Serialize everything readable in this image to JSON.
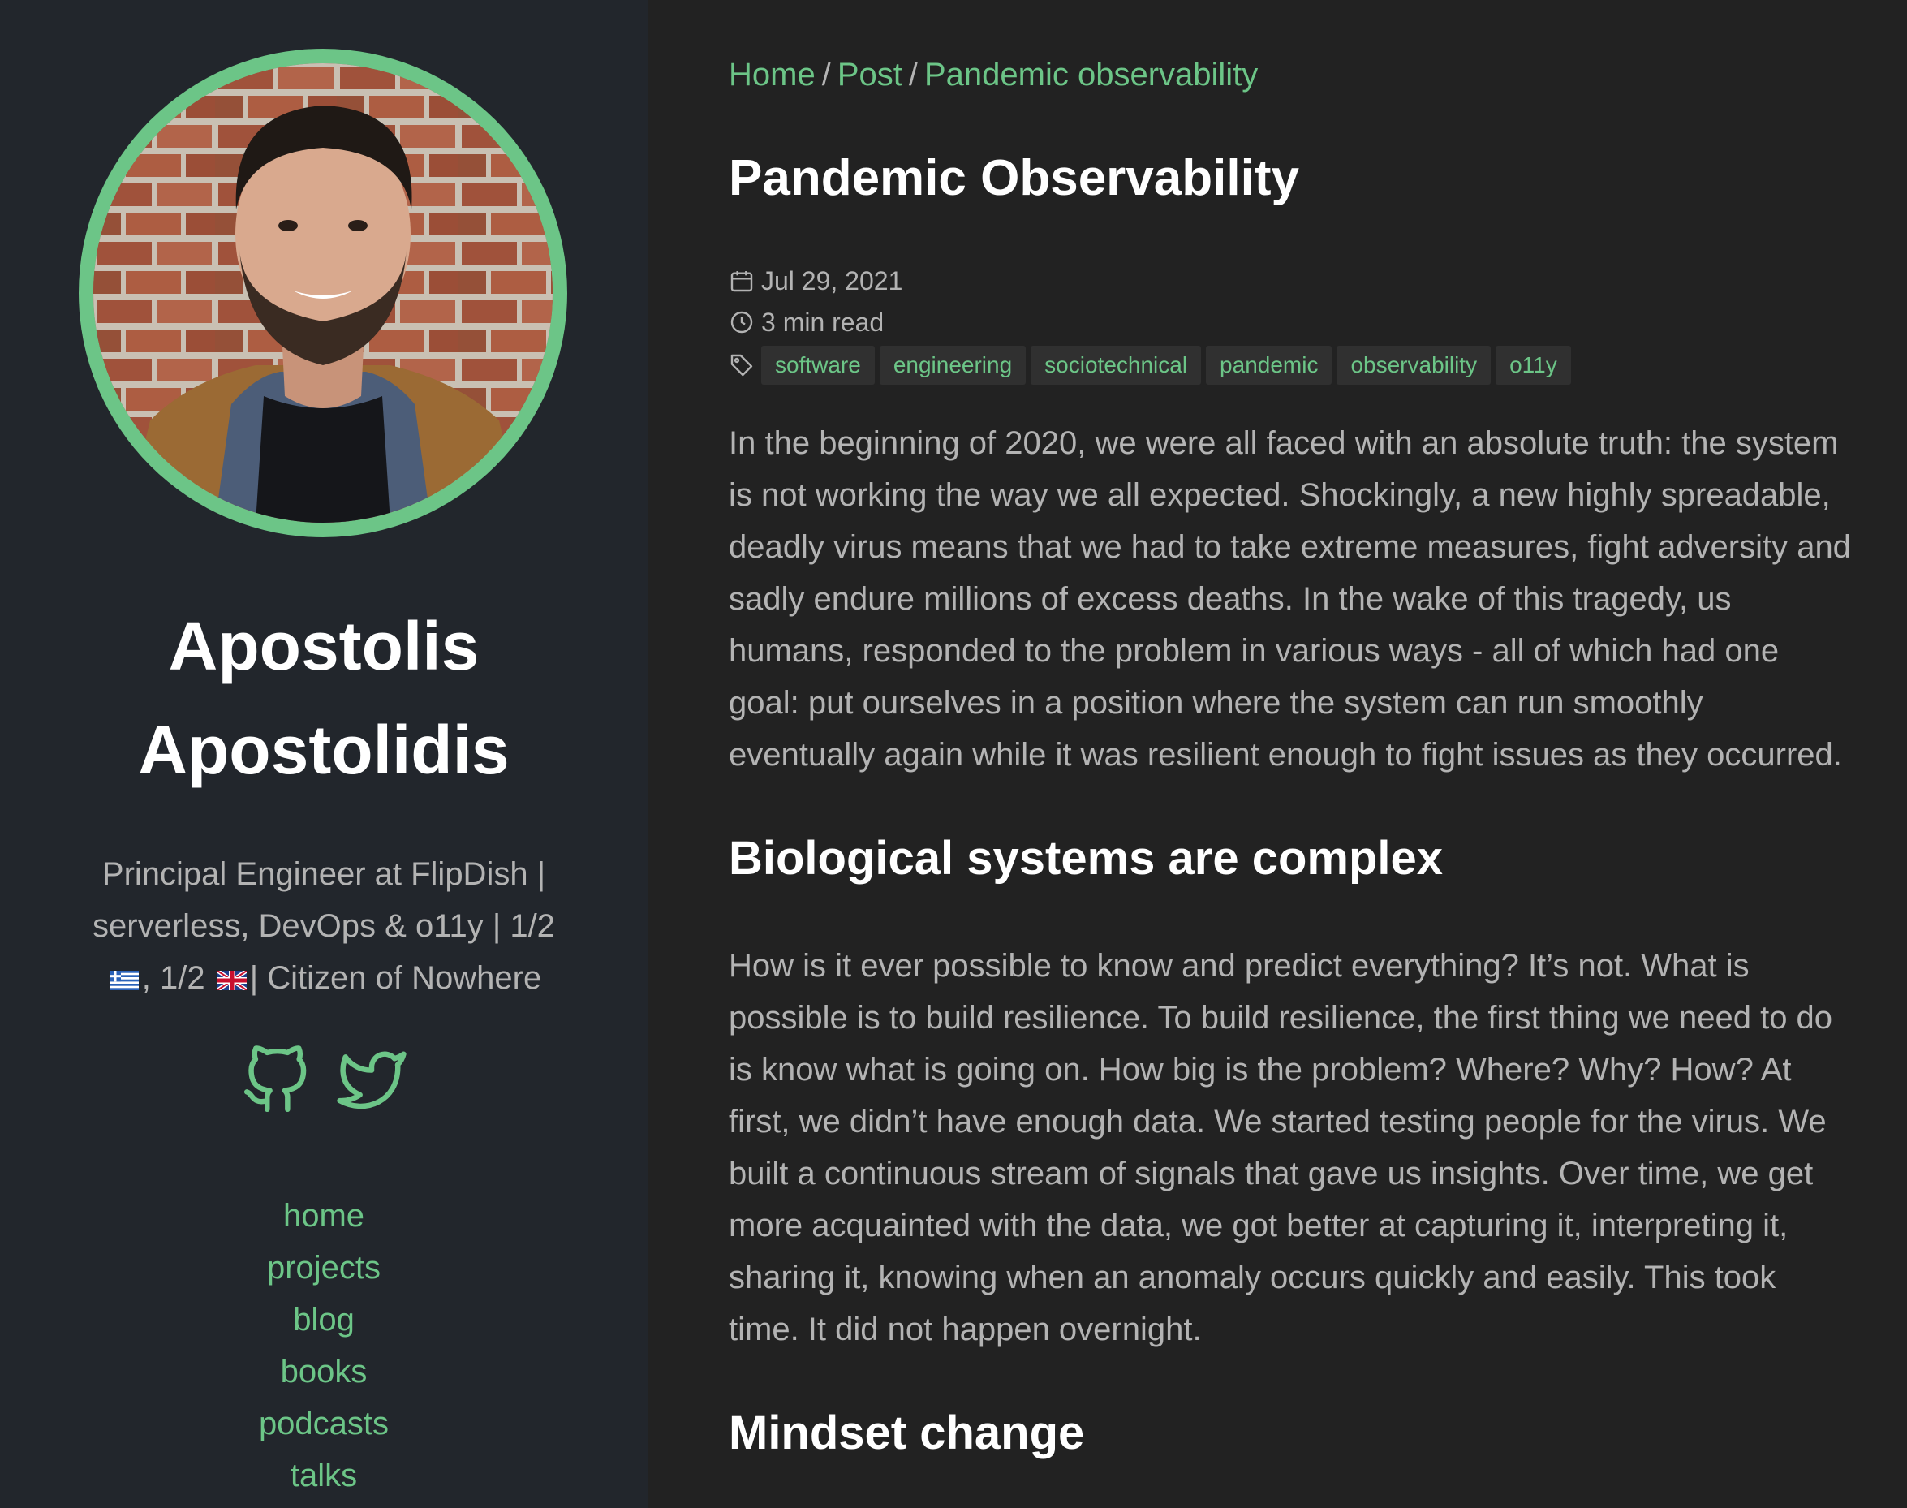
{
  "sidebar": {
    "author_name_line1": "Apostolis",
    "author_name_line2": "Apostolidis",
    "bio_line1": "Principal Engineer at FlipDish |",
    "bio_line2": "serverless, DevOps & o11y | 1/2",
    "bio_line3_part1": ", 1/2",
    "bio_line3_part2": "| Citizen of Nowhere",
    "social": [
      {
        "icon": "github-icon"
      },
      {
        "icon": "twitter-icon"
      }
    ],
    "nav": [
      {
        "label": "home"
      },
      {
        "label": "projects"
      },
      {
        "label": "blog"
      },
      {
        "label": "books"
      },
      {
        "label": "podcasts"
      },
      {
        "label": "talks"
      }
    ]
  },
  "breadcrumb": {
    "home": "Home",
    "sep": "/",
    "post": "Post",
    "current": "Pandemic observability"
  },
  "post": {
    "title": "Pandemic Observability",
    "date": "Jul 29, 2021",
    "read_time": "3 min read",
    "tags": [
      "software",
      "engineering",
      "sociotechnical",
      "pandemic",
      "observability",
      "o11y"
    ],
    "intro_lines": [
      "In the beginning of 2020, we were all faced with an absolute truth: the system",
      "is not working the way we all expected. Shockingly, a new highly spreadable,",
      "deadly virus means that we had to take extreme measures, fight adversity and",
      "sadly endure millions of excess deaths. In the wake of this tragedy, us",
      "humans, responded to the problem in various ways - all of which had one",
      "goal: put ourselves in a position where the system can run smoothly",
      "eventually again while it was resilient enough to fight issues as they occurred."
    ],
    "section1_heading": "Biological systems are complex",
    "section1_lines": [
      "How is it ever possible to know and predict everything? It’s not. What is",
      "possible is to build resilience. To build resilience, the first thing we need to do",
      "is know what is going on. How big is the problem? Where? Why? How? At",
      "first, we didn’t have enough data. We started testing people for the virus. We",
      "built a continuous stream of signals that gave us insights. Over time, we get",
      "more acquainted with the data, we got better at capturing it, interpreting it,",
      "sharing it, knowing when an anomaly occurs quickly and easily. This took",
      "time. It did not happen overnight."
    ],
    "section2_heading": "Mindset change"
  },
  "colors": {
    "accent": "#6cc587",
    "sidebar_bg": "#22262c",
    "main_bg": "#222222",
    "text_muted": "#b3b3b3",
    "heading": "#ffffff",
    "tag_bg": "#303030"
  }
}
